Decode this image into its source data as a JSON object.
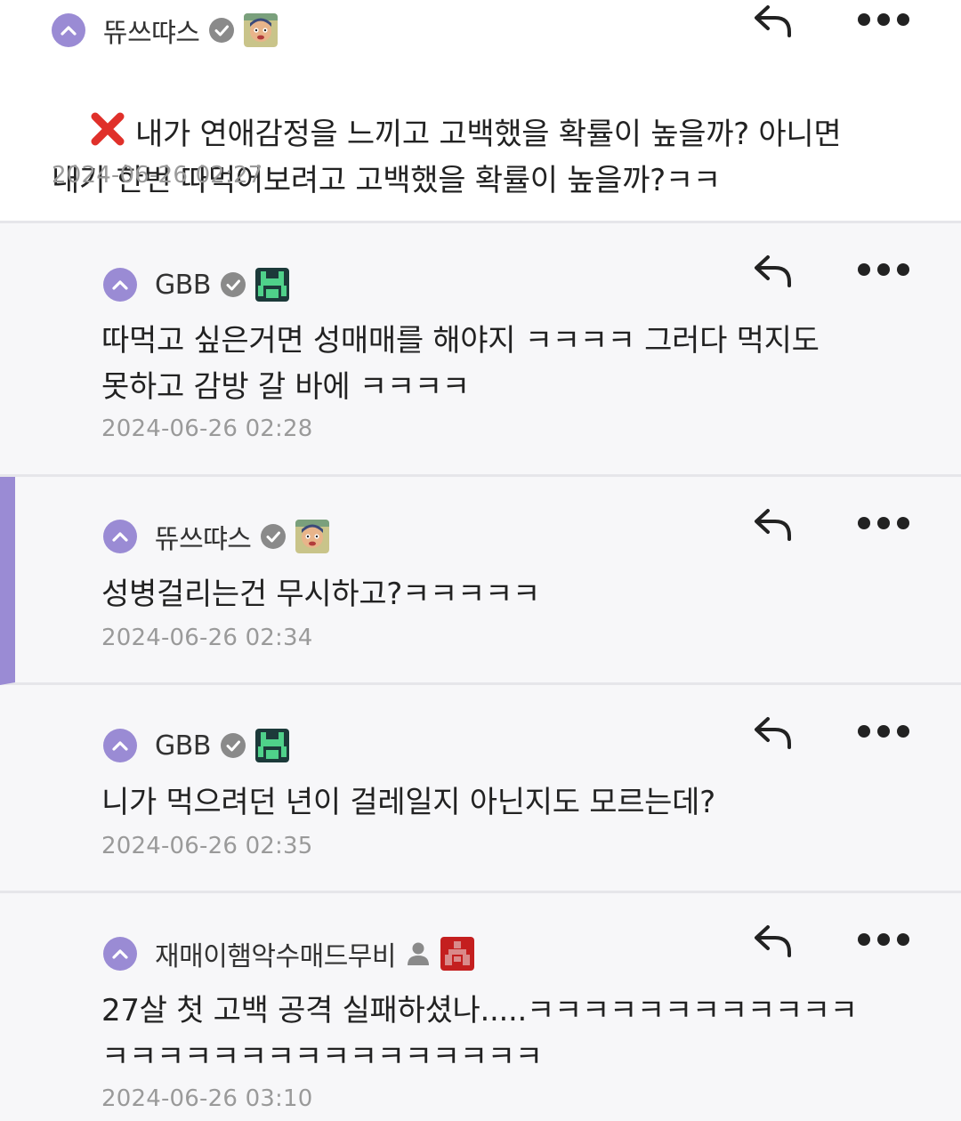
{
  "comments": [
    {
      "author": "뜌쓰땨스",
      "text": "내가 연애감정을 느끼고 고백했을 확률이 높을까? 아니면\n내가 한번 따먹어보려고 고백했을 확률이 높을까?ㅋㅋ",
      "time": "2024-06-26 02:27",
      "badge": "verified-check-icon"
    },
    {
      "author": "GBB",
      "text": "따먹고 싶은거면 성매매를 해야지 ㅋㅋㅋㅋ 그러다 먹지도\n못하고 감방 갈 바에 ㅋㅋㅋㅋ",
      "time": "2024-06-26 02:28",
      "badge": "verified-check-icon"
    },
    {
      "author": "뜌쓰땨스",
      "text": "성병걸리는건 무시하고?ㅋㅋㅋㅋㅋ",
      "time": "2024-06-26 02:34",
      "badge": "verified-check-icon"
    },
    {
      "author": "GBB",
      "text": "니가 먹으려던 년이 걸레일지 아닌지도 모르는데?",
      "time": "2024-06-26 02:35",
      "badge": "verified-check-icon"
    },
    {
      "author": "재매이햄악수매드무비",
      "text": "27살 첫 고백 공격 실패하셨나.....ㅋㅋㅋㅋㅋㅋㅋㅋㅋㅋㅋㅋ\nㅋㅋㅋㅋㅋㅋㅋㅋㅋㅋㅋㅋㅋㅋㅋㅋ",
      "time": "2024-06-26 03:10",
      "badge": "user-icon"
    }
  ],
  "colors": {
    "accent": "#9a8bd4",
    "reply_bg": "#f7f7f9",
    "divider": "#e6e6ea",
    "timestamp": "#9a9a9a",
    "deleted_mark": "#e0302a"
  }
}
